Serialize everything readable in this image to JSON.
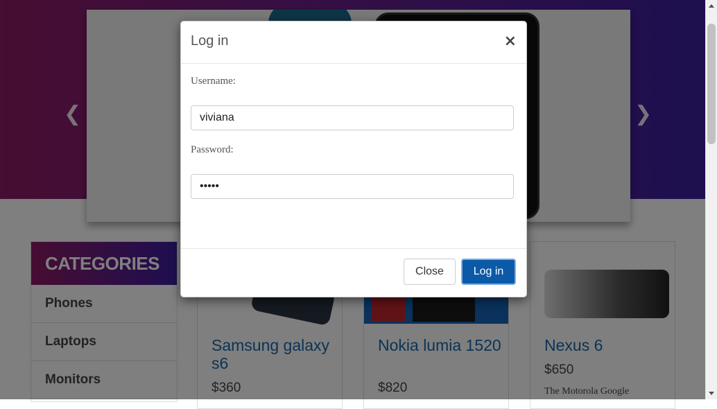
{
  "carousel": {
    "prev_icon": "chevron-left",
    "next_icon": "chevron-right"
  },
  "categories": {
    "title": "CATEGORIES",
    "items": [
      {
        "label": "Phones"
      },
      {
        "label": "Laptops"
      },
      {
        "label": "Monitors"
      }
    ]
  },
  "products": [
    {
      "title": "Samsung galaxy s6",
      "price": "$360",
      "desc": ""
    },
    {
      "title": "Nokia lumia 1520",
      "price": "$820",
      "desc": ""
    },
    {
      "title": "Nexus 6",
      "price": "$650",
      "desc": "The Motorola Google"
    }
  ],
  "modal": {
    "title": "Log in",
    "close_symbol": "×",
    "username_label": "Username:",
    "username_value": "viviana",
    "password_label": "Password:",
    "password_value": "•••••",
    "close_button": "Close",
    "login_button": "Log in"
  },
  "colors": {
    "accent": "#0b5aa8",
    "brand_start": "#8e1a64",
    "brand_end": "#3b1ea0"
  }
}
